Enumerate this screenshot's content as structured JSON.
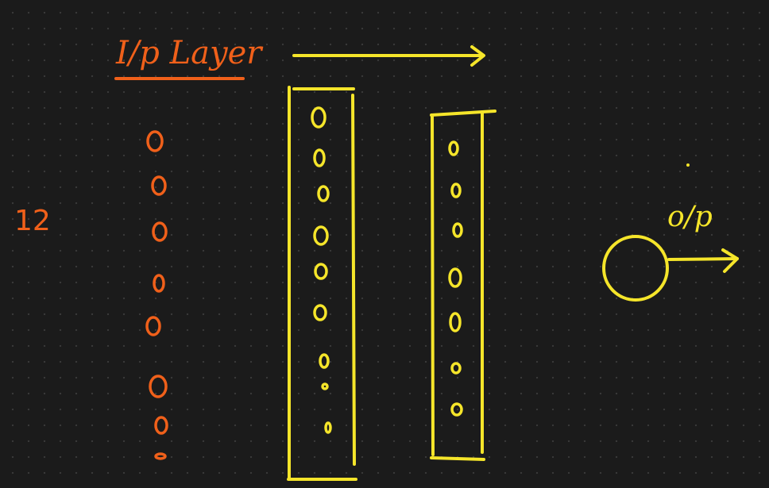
{
  "labels": {
    "input_layer": "I/p Layer",
    "input_count": "12",
    "output": "o/p"
  },
  "colors": {
    "background": "#1b1b1b",
    "input_color": "#f0601a",
    "layer_color": "#f5e52a"
  },
  "input_layer": {
    "neuron_count": 8
  },
  "hidden_layer_1": {
    "neuron_count": 9
  },
  "hidden_layer_2": {
    "neuron_count": 7
  },
  "output_layer": {
    "neuron_count": 1
  },
  "icons": {
    "flow_arrow": "right-arrow-icon",
    "output_arrow": "right-arrow-icon"
  }
}
